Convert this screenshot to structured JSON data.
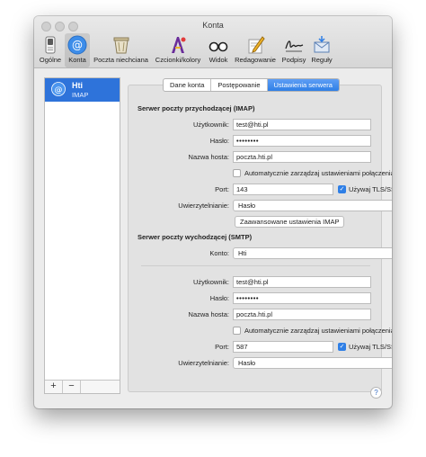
{
  "window": {
    "title": "Konta"
  },
  "toolbar": [
    {
      "label": "Ogólne",
      "icon": "switch-icon"
    },
    {
      "label": "Konta",
      "icon": "at-sign-icon"
    },
    {
      "label": "Poczta niechciana",
      "icon": "junk-trash-icon"
    },
    {
      "label": "Czcionki/kolory",
      "icon": "font-color-icon"
    },
    {
      "label": "Widok",
      "icon": "glasses-icon"
    },
    {
      "label": "Redagowanie",
      "icon": "pencil-icon"
    },
    {
      "label": "Podpisy",
      "icon": "signature-icon"
    },
    {
      "label": "Reguły",
      "icon": "rules-envelope-icon"
    }
  ],
  "sidebar": {
    "accounts": [
      {
        "name": "Hti",
        "type": "IMAP"
      }
    ],
    "add_label": "+",
    "remove_label": "−"
  },
  "tabs": [
    "Dane konta",
    "Postępowanie",
    "Ustawienia serwera"
  ],
  "incoming": {
    "section_title": "Serwer poczty przychodzącej (IMAP)",
    "username_label": "Użytkownik:",
    "username": "test@hti.pl",
    "password_label": "Hasło:",
    "password": "••••••••",
    "host_label": "Nazwa hosta:",
    "host": "poczta.hti.pl",
    "auto_label": "Automatycznie zarządzaj ustawieniami połączenia",
    "port_label": "Port:",
    "port": "143",
    "tls_label": "Używaj TLS/SSL",
    "auth_label": "Uwierzytelnianie:",
    "auth_value": "Hasło",
    "advanced_button": "Zaawansowane ustawienia IMAP"
  },
  "outgoing": {
    "section_title": "Serwer poczty wychodzącej (SMTP)",
    "account_label": "Konto:",
    "account_value": "Hti",
    "username_label": "Użytkownik:",
    "username": "test@hti.pl",
    "password_label": "Hasło:",
    "password": "••••••••",
    "host_label": "Nazwa hosta:",
    "host": "poczta.hti.pl",
    "auto_label": "Automatycznie zarządzaj ustawieniami połączenia",
    "port_label": "Port:",
    "port": "587",
    "tls_label": "Używaj TLS/SSL",
    "auth_label": "Uwierzytelnianie:",
    "auth_value": "Hasło"
  },
  "help_label": "?",
  "colors": {
    "accent": "#2f7fe6",
    "selection": "#2e73da"
  }
}
